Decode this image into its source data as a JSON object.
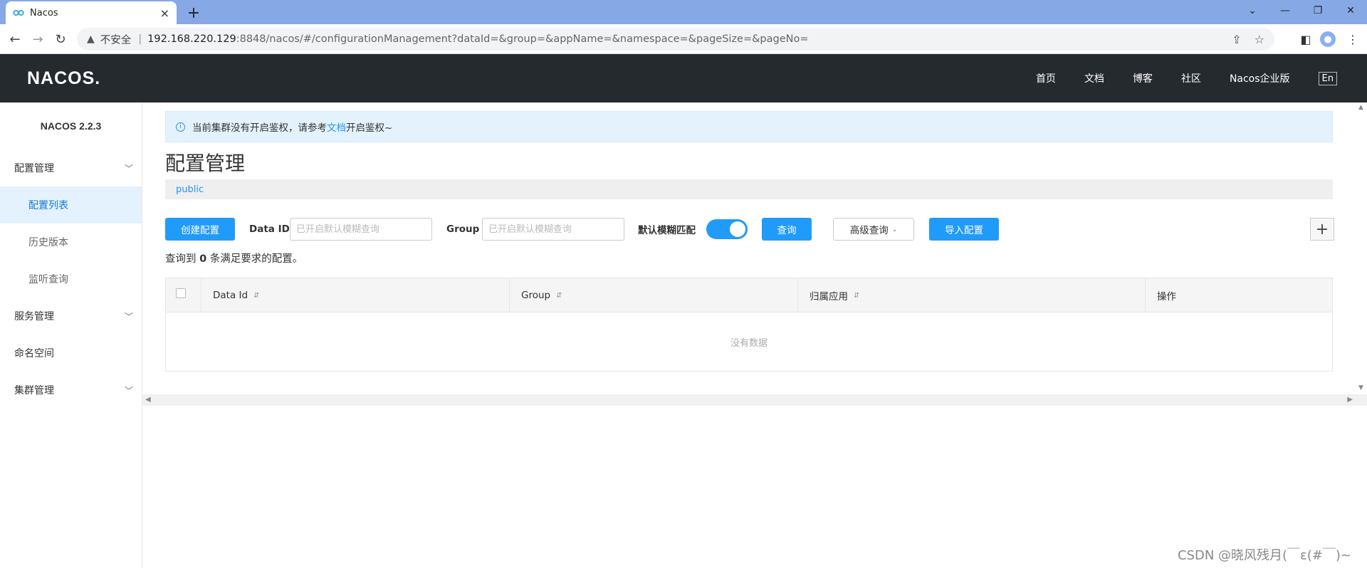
{
  "browser": {
    "tab_title": "Nacos",
    "tab_close": "×",
    "new_tab": "+",
    "insecure_label": "不安全",
    "url_host": "192.168.220.129",
    "url_rest": ":8848/nacos/#/configurationManagement?dataId=&group=&appName=&namespace=&pageSize=&pageNo="
  },
  "header": {
    "logo": "NACOS.",
    "nav": [
      "首页",
      "文档",
      "博客",
      "社区",
      "Nacos企业版"
    ],
    "lang": "En"
  },
  "sidebar": {
    "version": "NACOS 2.2.3",
    "groups": {
      "config": "配置管理",
      "config_items": [
        "配置列表",
        "历史版本",
        "监听查询"
      ],
      "service": "服务管理",
      "namespace": "命名空间",
      "cluster": "集群管理"
    }
  },
  "notice": {
    "prefix": "当前集群没有开启鉴权，请参考",
    "link": "文档",
    "suffix": "开启鉴权~"
  },
  "page": {
    "title": "配置管理",
    "namespace": "public"
  },
  "filters": {
    "create_button": "创建配置",
    "data_id_label": "Data ID",
    "data_id_placeholder": "已开启默认模糊查询",
    "group_label": "Group",
    "group_placeholder": "已开启默认模糊查询",
    "fuzzy_label": "默认模糊匹配",
    "fuzzy_enabled": true,
    "search_button": "查询",
    "advanced_button": "高级查询",
    "import_button": "导入配置",
    "plus_button": "+"
  },
  "result": {
    "prefix": "查询到",
    "count": "0",
    "suffix": "条满足要求的配置。"
  },
  "table": {
    "columns": [
      "Data Id",
      "Group",
      "归属应用",
      "操作"
    ],
    "empty_text": "没有数据"
  },
  "watermark": "CSDN @晓风残月(￣ε(#￣)~"
}
